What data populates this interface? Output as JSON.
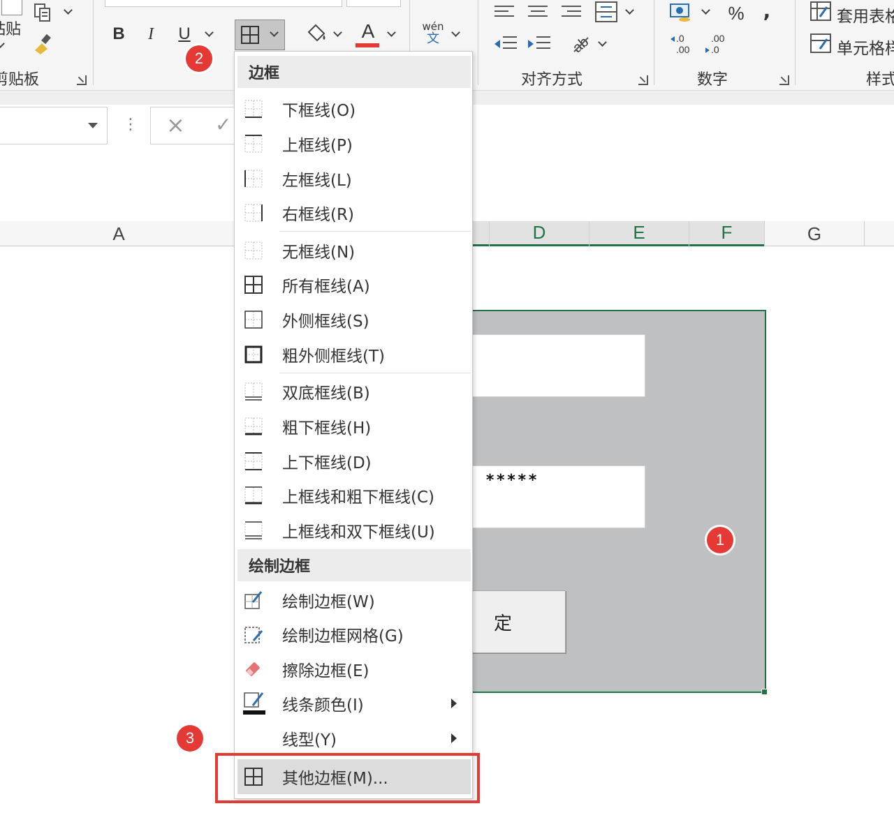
{
  "ribbon": {
    "paste_label": "粘贴",
    "clipboard_label": "剪贴板",
    "bold": "B",
    "italic": "I",
    "underline": "U",
    "font_color_letter": "A",
    "font_color_bar": "#e53935",
    "wen_label": "wén",
    "wen_char": "文",
    "alignment_label": "对齐方式",
    "number_label": "数字",
    "percent": "%",
    "comma": ",",
    "inc_decimal": ".00",
    "dec_decimal": ".0",
    "table_format_label": "套用表格",
    "cell_style_label": "单元格样",
    "styles_label": "样式"
  },
  "formula_bar": {
    "cancel_icon": "×",
    "enter_icon": "✓",
    "dots": "⋮"
  },
  "columns": [
    "A",
    "D",
    "E",
    "F",
    "G"
  ],
  "selected_columns": [
    "D",
    "E",
    "F"
  ],
  "form": {
    "password_mask": "*****",
    "ok_button_text": "定",
    "accent": "#217346"
  },
  "menu": {
    "section_borders": "边框",
    "items": [
      {
        "label": "下框线(O)",
        "icon": "bottom-border-icon"
      },
      {
        "label": "上框线(P)",
        "icon": "top-border-icon"
      },
      {
        "label": "左框线(L)",
        "icon": "left-border-icon"
      },
      {
        "label": "右框线(R)",
        "icon": "right-border-icon"
      },
      {
        "label": "无框线(N)",
        "icon": "no-border-icon"
      },
      {
        "label": "所有框线(A)",
        "icon": "all-borders-icon"
      },
      {
        "label": "外侧框线(S)",
        "icon": "outside-borders-icon"
      },
      {
        "label": "粗外侧框线(T)",
        "icon": "thick-outside-borders-icon"
      },
      {
        "label": "双底框线(B)",
        "icon": "double-bottom-border-icon"
      },
      {
        "label": "粗下框线(H)",
        "icon": "thick-bottom-border-icon"
      },
      {
        "label": "上下框线(D)",
        "icon": "top-bottom-border-icon"
      },
      {
        "label": "上框线和粗下框线(C)",
        "icon": "top-thick-bottom-border-icon"
      },
      {
        "label": "上框线和双下框线(U)",
        "icon": "top-double-bottom-border-icon"
      }
    ],
    "section_draw": "绘制边框",
    "draw_items": [
      {
        "label": "绘制边框(W)",
        "icon": "draw-border-icon"
      },
      {
        "label": "绘制边框网格(G)",
        "icon": "draw-border-grid-icon"
      },
      {
        "label": "擦除边框(E)",
        "icon": "eraser-icon"
      },
      {
        "label": "线条颜色(I)",
        "icon": "line-color-icon"
      },
      {
        "label": "线型(Y)",
        "icon": "line-style-icon"
      },
      {
        "label": "其他边框(M)...",
        "icon": "more-borders-icon"
      }
    ]
  },
  "annotations": {
    "badge_1": "1",
    "badge_2": "2",
    "badge_3": "3",
    "badge_color": "#e53935"
  }
}
